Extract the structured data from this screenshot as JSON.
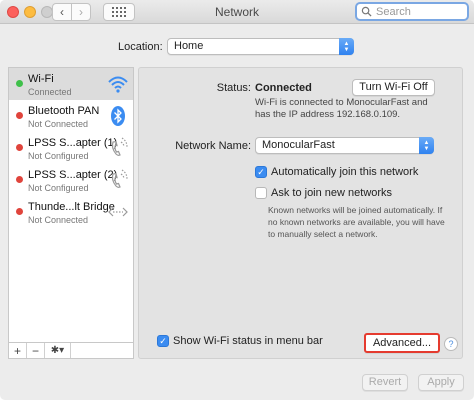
{
  "window": {
    "title": "Network",
    "search_placeholder": "Search"
  },
  "location": {
    "label": "Location:",
    "value": "Home"
  },
  "services": [
    {
      "name": "Wi-Fi",
      "status": "Connected",
      "dot_color": "#3fc04a",
      "icon": "wifi-icon"
    },
    {
      "name": "Bluetooth PAN",
      "status": "Not Connected",
      "dot_color": "#e0443c",
      "icon": "bluetooth-icon"
    },
    {
      "name": "LPSS S...apter (1)",
      "status": "Not Configured",
      "dot_color": "#e0443c",
      "icon": "phone-icon"
    },
    {
      "name": "LPSS S...apter (2)",
      "status": "Not Configured",
      "dot_color": "#e0443c",
      "icon": "phone-icon"
    },
    {
      "name": "Thunde...lt Bridge",
      "status": "Not Connected",
      "dot_color": "#e0443c",
      "icon": "thunderbolt-bridge-icon"
    }
  ],
  "sidebar_footer": {
    "add": "+",
    "remove": "−",
    "actions": "✱▾"
  },
  "status": {
    "label": "Status:",
    "value": "Connected",
    "toggle_button": "Turn Wi-Fi Off",
    "description": "Wi-Fi is connected to MonocularFast and has the IP address 192.168.0.109."
  },
  "network_name": {
    "label": "Network Name:",
    "value": "MonocularFast"
  },
  "options": {
    "auto_join": "Automatically join this network",
    "ask_join": "Ask to join new networks",
    "ask_join_desc": "Known networks will be joined automatically. If no known networks are available, you will have to manually select a network.",
    "show_menubar": "Show Wi-Fi status in menu bar"
  },
  "buttons": {
    "advanced": "Advanced...",
    "help": "?",
    "revert": "Revert",
    "apply": "Apply"
  },
  "colors": {
    "accent": "#3b8cf1",
    "highlight_border": "#e53b2f"
  }
}
